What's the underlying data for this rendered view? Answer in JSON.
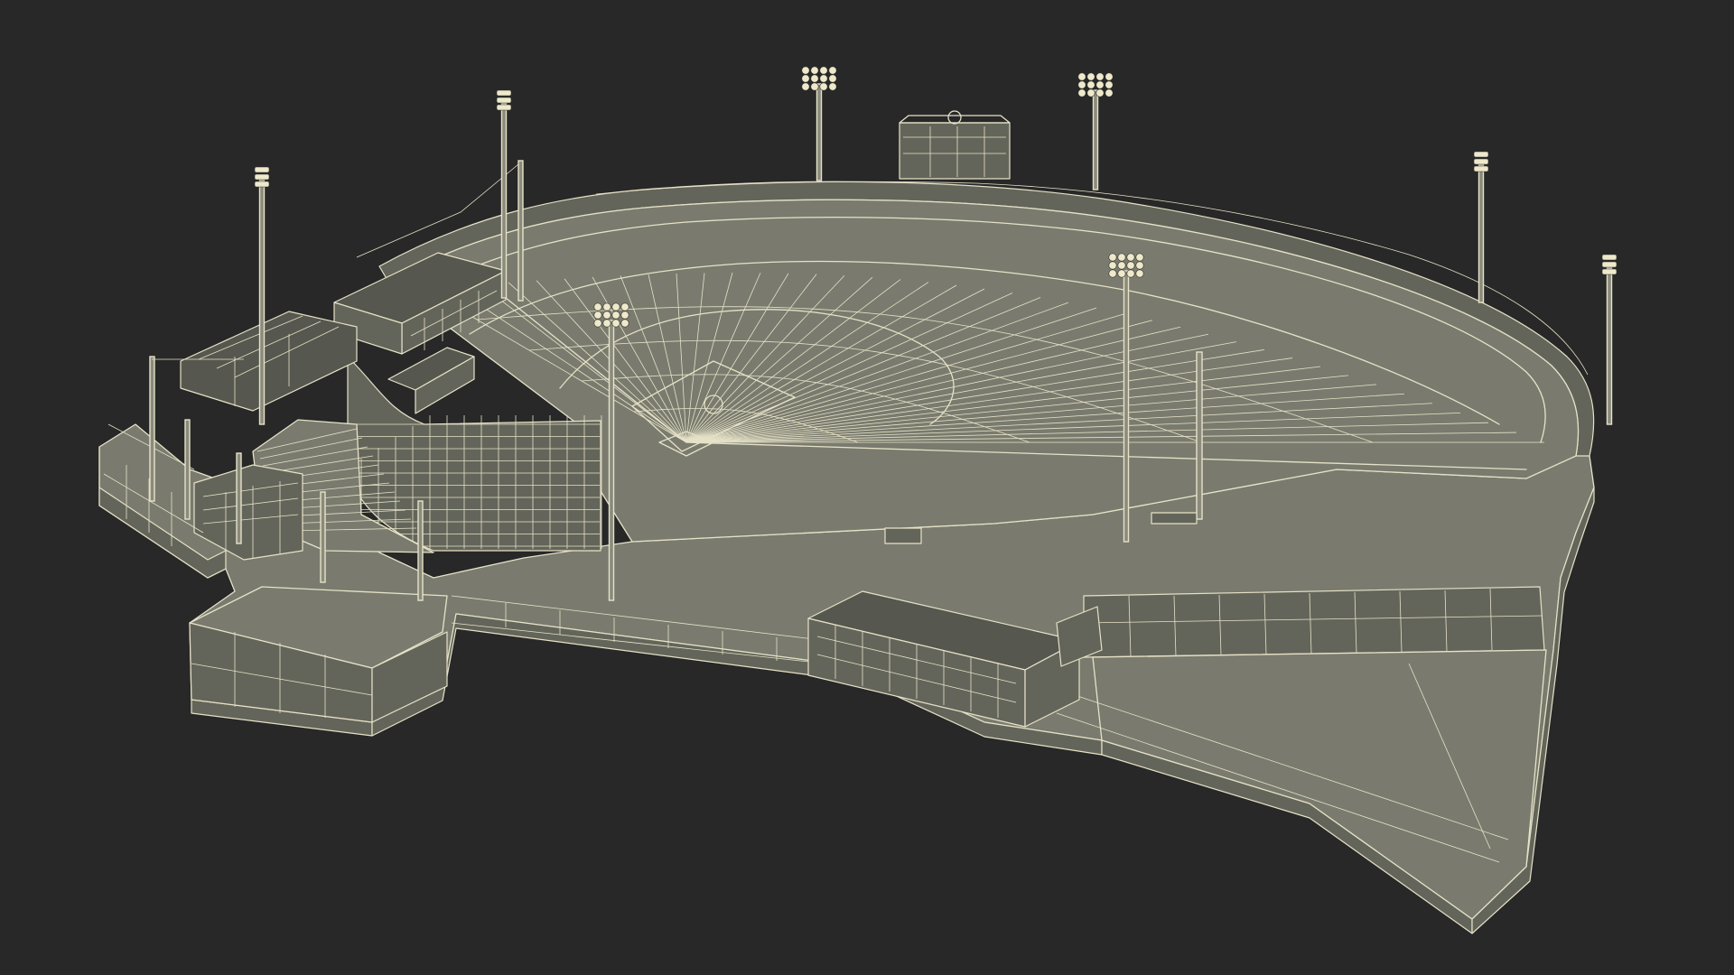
{
  "scene": {
    "background_color": "#282828",
    "wireframe_color": "#e6e2c8",
    "surface_color": "#7a7b6e",
    "subject": "baseball-stadium-wireframe-model",
    "light_towers": 9,
    "scoreboard_present": true,
    "labels_present": false
  }
}
